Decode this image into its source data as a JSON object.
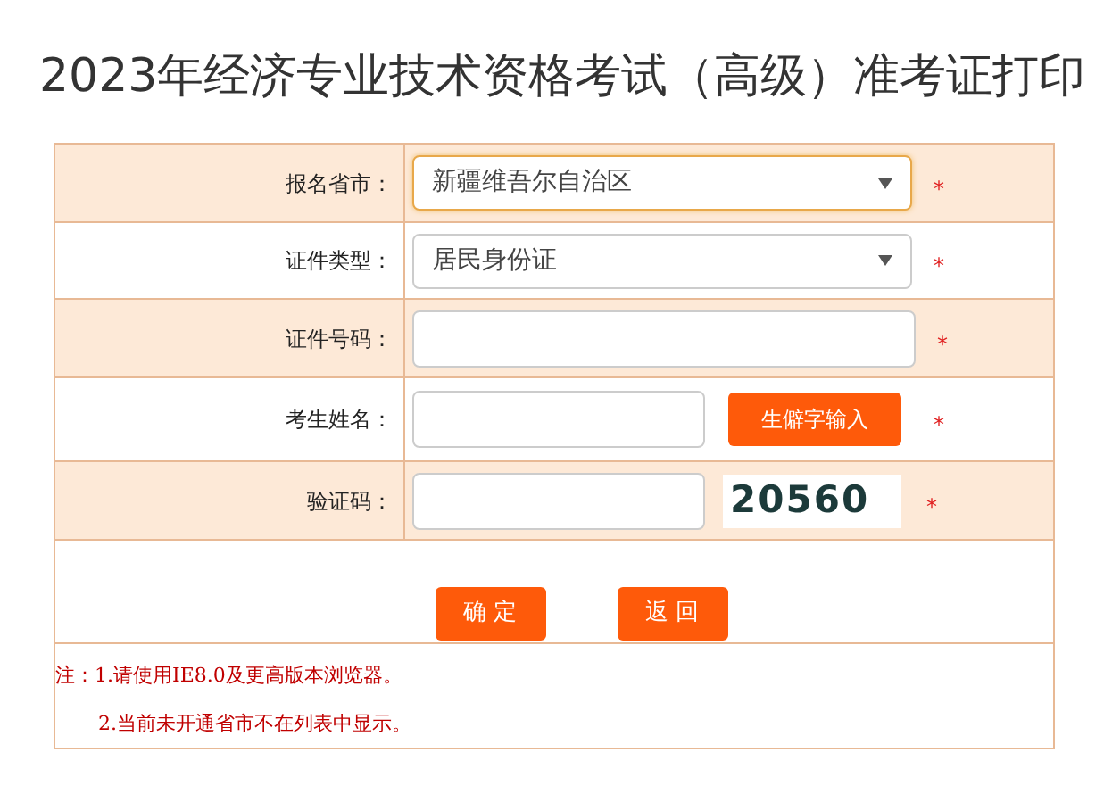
{
  "title": "2023年经济专业技术资格考试（高级）准考证打印",
  "rows": [
    {
      "kind": "select",
      "label": "报名省市：",
      "value": "新疆维吾尔自治区",
      "focused": true,
      "required": "*"
    },
    {
      "kind": "select",
      "label": "证件类型：",
      "value": "居民身份证",
      "focused": false,
      "required": "*"
    },
    {
      "kind": "input",
      "label": "证件号码：",
      "required": "*"
    },
    {
      "kind": "input_button",
      "label": "考生姓名：",
      "button": "生僻字输入",
      "required": "*"
    },
    {
      "kind": "captcha",
      "label": "验证码：",
      "captcha": "20560",
      "required": "*"
    }
  ],
  "buttons": [
    "确 定",
    "返 回"
  ],
  "notes": [
    "注：1.请使用IE8.0及更高版本浏览器。",
    "2.当前未开通省市不在列表中显示。"
  ]
}
